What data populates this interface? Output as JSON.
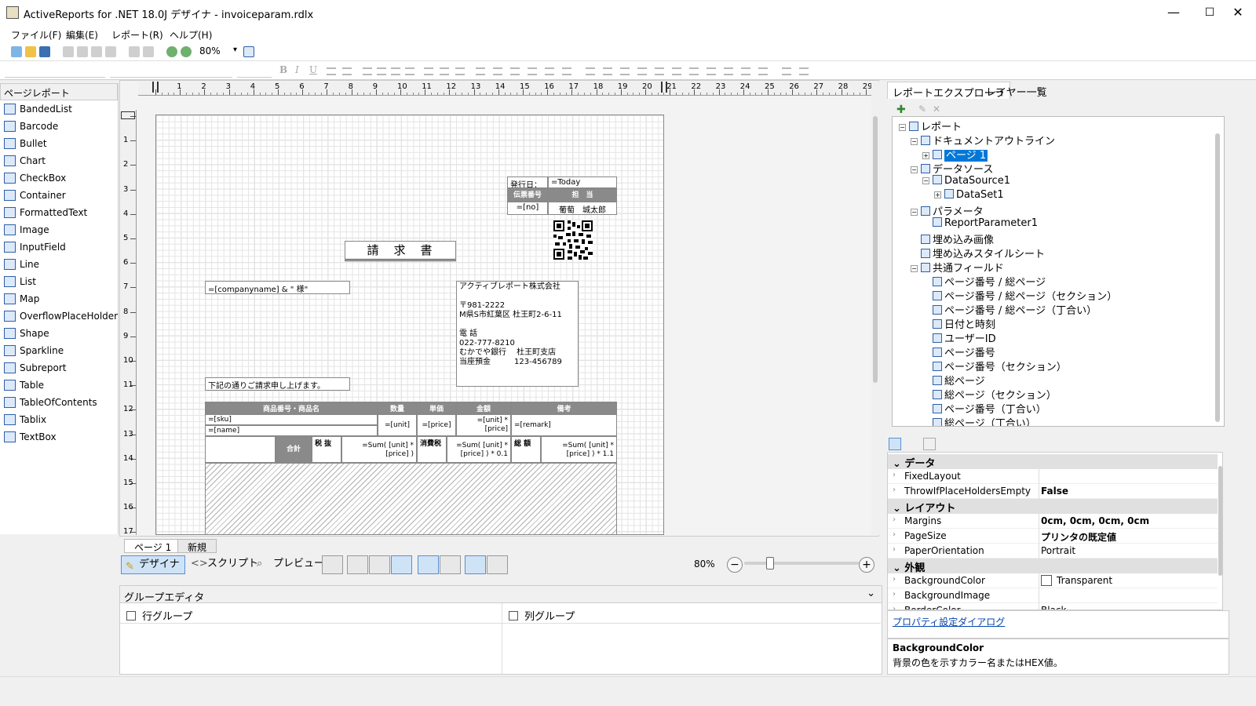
{
  "window": {
    "title": "ActiveReports for .NET 18.0J デザイナ - invoiceparam.rdlx",
    "minimize": "—",
    "maximize": "☐",
    "close": "✕"
  },
  "menu": [
    "ファイル(F)",
    "編集(E)",
    "レポート(R)",
    "ヘルプ(H)"
  ],
  "toolbar": {
    "zoom": "80%",
    "zoom_arrow": "▾",
    "bold": "B",
    "italic": "I",
    "underline": "U"
  },
  "toolbox": {
    "header": "ページレポート",
    "items": [
      "BandedList",
      "Barcode",
      "Bullet",
      "Chart",
      "CheckBox",
      "Container",
      "FormattedText",
      "Image",
      "InputField",
      "Line",
      "List",
      "Map",
      "OverflowPlaceHolder",
      "Shape",
      "Sparkline",
      "Subreport",
      "Table",
      "TableOfContents",
      "Tablix",
      "TextBox"
    ]
  },
  "ruler": {
    "h": [
      "1",
      "2",
      "3",
      "4",
      "5",
      "6",
      "7",
      "8",
      "9",
      "10",
      "11",
      "12",
      "13",
      "14",
      "15",
      "16",
      "17",
      "18",
      "19",
      "20",
      "21",
      "22",
      "23",
      "24",
      "25",
      "26",
      "27",
      "28",
      "29"
    ],
    "v": [
      "1",
      "2",
      "3",
      "4",
      "5",
      "6",
      "7",
      "8",
      "9",
      "10",
      "11",
      "12",
      "13",
      "14",
      "15",
      "16",
      "17"
    ]
  },
  "report": {
    "issue_label": "発行日：",
    "issue_value": "=Today",
    "slip_no_label": "伝票番号",
    "staff_label": "担　当",
    "slip_no_value": "=[no]",
    "staff_value": "葡萄　城太郎",
    "title": "請　求　書",
    "company_field": "=[companyname] & \" 様\"",
    "sender": [
      "アクティブレポート株式会社",
      "",
      "〒981-2222",
      "M県S市紅葉区 杜王町2-6-11",
      "",
      "電 話",
      "022-777-8210",
      "むかでや銀行　 杜王町支店",
      "当座預金　　　123-456789"
    ],
    "note": "下記の通りご請求申し上げます。",
    "table_headers": [
      "商品番号・商品名",
      "数量",
      "単価",
      "金額",
      "備考"
    ],
    "sku": "=[sku]",
    "name": "=[name]",
    "unit": "=[unit]",
    "price": "=[price]",
    "amount": "=[unit] * [price]",
    "remark": "=[remark]",
    "total_label": "合計",
    "tax_excl_label": "税 抜",
    "tax_excl_value": "=Sum( [unit] * [price] )",
    "tax_label": "消費税",
    "tax_value": "=Sum( [unit] * [price] ) * 0.1",
    "grand_label": "総 額",
    "grand_value": "=Sum( [unit] * [price] ) * 1.1"
  },
  "page_tabs": [
    "ページ 1",
    "新規"
  ],
  "modes": {
    "design": "デザイナ",
    "script": "スクリプト",
    "preview": "プレビュー"
  },
  "zoom_percent": "80%",
  "zoom_minus": "−",
  "zoom_plus": "+",
  "group_editor": {
    "title": "グループエディタ",
    "row_groups": "行グループ",
    "col_groups": "列グループ",
    "collapse": "⌄"
  },
  "right_tabs": [
    "レポートエクスプローラ",
    "レイヤー一覧"
  ],
  "explorer_tree": [
    {
      "label": "レポート",
      "level": 0,
      "expander": "−"
    },
    {
      "label": "ドキュメントアウトライン",
      "level": 1,
      "expander": "−"
    },
    {
      "label": "ページ 1",
      "level": 2,
      "expander": "+",
      "selected": true
    },
    {
      "label": "データソース",
      "level": 1,
      "expander": "−"
    },
    {
      "label": "DataSource1",
      "level": 2,
      "expander": "−"
    },
    {
      "label": "DataSet1",
      "level": 3,
      "expander": "+"
    },
    {
      "label": "パラメータ",
      "level": 1,
      "expander": "−"
    },
    {
      "label": "ReportParameter1",
      "level": 2,
      "expander": ""
    },
    {
      "label": "埋め込み画像",
      "level": 1,
      "expander": ""
    },
    {
      "label": "埋め込みスタイルシート",
      "level": 1,
      "expander": ""
    },
    {
      "label": "共通フィールド",
      "level": 1,
      "expander": "−"
    },
    {
      "label": "ページ番号 / 総ページ",
      "level": 2,
      "expander": ""
    },
    {
      "label": "ページ番号 / 総ページ（セクション）",
      "level": 2,
      "expander": ""
    },
    {
      "label": "ページ番号 / 総ページ（丁合い）",
      "level": 2,
      "expander": ""
    },
    {
      "label": "日付と時刻",
      "level": 2,
      "expander": ""
    },
    {
      "label": "ユーザーID",
      "level": 2,
      "expander": ""
    },
    {
      "label": "ページ番号",
      "level": 2,
      "expander": ""
    },
    {
      "label": "ページ番号（セクション）",
      "level": 2,
      "expander": ""
    },
    {
      "label": "総ページ",
      "level": 2,
      "expander": ""
    },
    {
      "label": "総ページ（セクション）",
      "level": 2,
      "expander": ""
    },
    {
      "label": "ページ番号（丁合い）",
      "level": 2,
      "expander": ""
    },
    {
      "label": "総ページ（丁合い）",
      "level": 2,
      "expander": ""
    }
  ],
  "properties": [
    {
      "type": "cat",
      "name": "データ"
    },
    {
      "type": "prop",
      "name": "FixedLayout",
      "value": "",
      "bold": false
    },
    {
      "type": "prop",
      "name": "ThrowIfPlaceHoldersEmpty",
      "value": "False",
      "bold": true
    },
    {
      "type": "cat",
      "name": "レイアウト"
    },
    {
      "type": "prop",
      "name": "Margins",
      "value": "0cm, 0cm, 0cm, 0cm",
      "bold": true
    },
    {
      "type": "prop",
      "name": "PageSize",
      "value": "プリンタの既定値",
      "bold": true
    },
    {
      "type": "prop",
      "name": "PaperOrientation",
      "value": "Portrait",
      "bold": false
    },
    {
      "type": "cat",
      "name": "外観"
    },
    {
      "type": "prop",
      "name": "BackgroundColor",
      "value": "Transparent",
      "bold": false,
      "swatch": true
    },
    {
      "type": "prop",
      "name": "BackgroundImage",
      "value": "",
      "bold": false
    },
    {
      "type": "prop",
      "name": "BorderColor",
      "value": "Black",
      "bold": false
    }
  ],
  "property_dialog_link": "プロパティ設定ダイアログ",
  "description": {
    "name": "BackgroundColor",
    "text": "背景の色を示すカラー名またはHEX値。"
  },
  "colors": {
    "accent": "#0078d7",
    "header_gray": "#8a8a8a",
    "icon_blue": "#2f5fa7"
  }
}
